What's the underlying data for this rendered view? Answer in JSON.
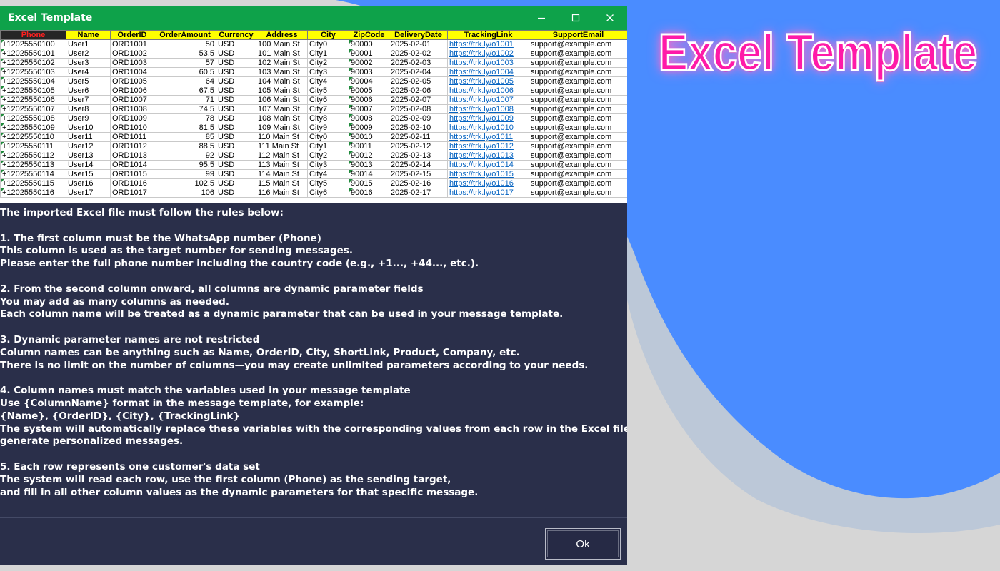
{
  "window": {
    "title": "Excel Template"
  },
  "promo": {
    "title": "Excel Template"
  },
  "colors": {
    "titlebar": "#0ea24a",
    "panel": "#2a2f4a",
    "header": "#ffff00",
    "accent": "#ff1aa8",
    "blob": "#4a8cff"
  },
  "icons": {
    "minimize": "minimize-icon",
    "maximize": "maximize-icon",
    "close": "close-icon"
  },
  "table": {
    "columns": [
      "Phone",
      "Name",
      "OrderID",
      "OrderAmount",
      "Currency",
      "Address",
      "City",
      "ZipCode",
      "DeliveryDate",
      "TrackingLink",
      "SupportEmail"
    ],
    "rows": [
      [
        "+12025550100",
        "User1",
        "ORD1001",
        "50",
        "USD",
        "100 Main St",
        "City0",
        "90000",
        "2025-02-01",
        "https://trk.ly/o1001",
        "support@example.com"
      ],
      [
        "+12025550101",
        "User2",
        "ORD1002",
        "53.5",
        "USD",
        "101 Main St",
        "City1",
        "90001",
        "2025-02-02",
        "https://trk.ly/o1002",
        "support@example.com"
      ],
      [
        "+12025550102",
        "User3",
        "ORD1003",
        "57",
        "USD",
        "102 Main St",
        "City2",
        "90002",
        "2025-02-03",
        "https://trk.ly/o1003",
        "support@example.com"
      ],
      [
        "+12025550103",
        "User4",
        "ORD1004",
        "60.5",
        "USD",
        "103 Main St",
        "City3",
        "90003",
        "2025-02-04",
        "https://trk.ly/o1004",
        "support@example.com"
      ],
      [
        "+12025550104",
        "User5",
        "ORD1005",
        "64",
        "USD",
        "104 Main St",
        "City4",
        "90004",
        "2025-02-05",
        "https://trk.ly/o1005",
        "support@example.com"
      ],
      [
        "+12025550105",
        "User6",
        "ORD1006",
        "67.5",
        "USD",
        "105 Main St",
        "City5",
        "90005",
        "2025-02-06",
        "https://trk.ly/o1006",
        "support@example.com"
      ],
      [
        "+12025550106",
        "User7",
        "ORD1007",
        "71",
        "USD",
        "106 Main St",
        "City6",
        "90006",
        "2025-02-07",
        "https://trk.ly/o1007",
        "support@example.com"
      ],
      [
        "+12025550107",
        "User8",
        "ORD1008",
        "74.5",
        "USD",
        "107 Main St",
        "City7",
        "90007",
        "2025-02-08",
        "https://trk.ly/o1008",
        "support@example.com"
      ],
      [
        "+12025550108",
        "User9",
        "ORD1009",
        "78",
        "USD",
        "108 Main St",
        "City8",
        "90008",
        "2025-02-09",
        "https://trk.ly/o1009",
        "support@example.com"
      ],
      [
        "+12025550109",
        "User10",
        "ORD1010",
        "81.5",
        "USD",
        "109 Main St",
        "City9",
        "90009",
        "2025-02-10",
        "https://trk.ly/o1010",
        "support@example.com"
      ],
      [
        "+12025550110",
        "User11",
        "ORD1011",
        "85",
        "USD",
        "110 Main St",
        "City0",
        "90010",
        "2025-02-11",
        "https://trk.ly/o1011",
        "support@example.com"
      ],
      [
        "+12025550111",
        "User12",
        "ORD1012",
        "88.5",
        "USD",
        "111 Main St",
        "City1",
        "90011",
        "2025-02-12",
        "https://trk.ly/o1012",
        "support@example.com"
      ],
      [
        "+12025550112",
        "User13",
        "ORD1013",
        "92",
        "USD",
        "112 Main St",
        "City2",
        "90012",
        "2025-02-13",
        "https://trk.ly/o1013",
        "support@example.com"
      ],
      [
        "+12025550113",
        "User14",
        "ORD1014",
        "95.5",
        "USD",
        "113 Main St",
        "City3",
        "90013",
        "2025-02-14",
        "https://trk.ly/o1014",
        "support@example.com"
      ],
      [
        "+12025550114",
        "User15",
        "ORD1015",
        "99",
        "USD",
        "114 Main St",
        "City4",
        "90014",
        "2025-02-15",
        "https://trk.ly/o1015",
        "support@example.com"
      ],
      [
        "+12025550115",
        "User16",
        "ORD1016",
        "102.5",
        "USD",
        "115 Main St",
        "City5",
        "90015",
        "2025-02-16",
        "https://trk.ly/o1016",
        "support@example.com"
      ],
      [
        "+12025550116",
        "User17",
        "ORD1017",
        "106",
        "USD",
        "116 Main St",
        "City6",
        "90016",
        "2025-02-17",
        "https://trk.ly/o1017",
        "support@example.com"
      ]
    ]
  },
  "instructions": [
    "The imported Excel file must follow the rules below:",
    "",
    "1. The first column must be the WhatsApp number (Phone)",
    "This column is used as the target number for sending messages.",
    "Please enter the full phone number including the country code (e.g., +1..., +44..., etc.).",
    "",
    "2. From the second column onward, all columns are dynamic parameter fields",
    "You may add as many columns as needed.",
    "Each column name will be treated as a dynamic parameter that can be used in your message template.",
    "",
    "3. Dynamic parameter names are not restricted",
    "Column names can be anything such as Name, OrderID, City, ShortLink, Product, Company, etc.",
    "There is no limit on the number of columns—you may create unlimited parameters according to your needs.",
    "",
    "4. Column names must match the variables used in your message template",
    "Use {ColumnName} format in the message template, for example:",
    "{Name}, {OrderID}, {City}, {TrackingLink}",
    "The system will automatically replace these variables with the corresponding values from each row in the Excel file to",
    "generate personalized messages.",
    "",
    "5. Each row represents one customer's data set",
    "The system will read each row, use the first column (Phone) as the sending target,",
    "and fill in all other column values as the dynamic parameters for that specific message."
  ],
  "buttons": {
    "ok": "Ok"
  }
}
